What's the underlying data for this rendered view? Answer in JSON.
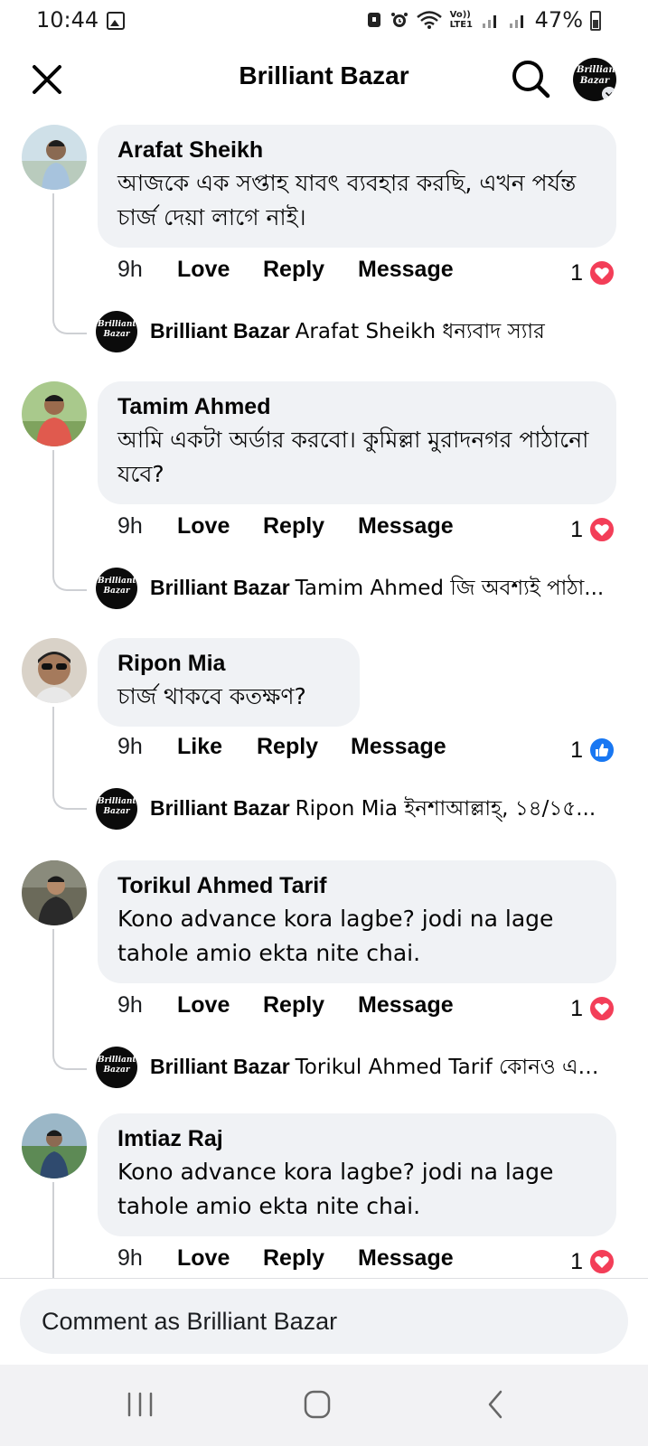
{
  "status_bar": {
    "time": "10:44",
    "battery": "47%",
    "network_label": "Vo)) LTE1"
  },
  "header": {
    "title": "Brilliant Bazar",
    "page_avatar_text": "Brilliant Bazar"
  },
  "comments": [
    {
      "author": "Arafat Sheikh",
      "text": "আজকে এক সপ্তাহ যাবৎ ব্যবহার করছি, এখন পর্যন্ত চার্জ দেয়া লাগে নাই।",
      "time": "9h",
      "react_label": "Love",
      "reply_label": "Reply",
      "message_label": "Message",
      "reaction_count": "1",
      "reaction_type": "love-icon",
      "reply": {
        "author": "Brilliant Bazar",
        "text": "Arafat Sheikh ধন্যবাদ স্যার"
      }
    },
    {
      "author": "Tamim Ahmed",
      "text": "আমি একটা অর্ডার করবো। কুমিল্লা মুরাদনগর পাঠানো যবে?",
      "time": "9h",
      "react_label": "Love",
      "reply_label": "Reply",
      "message_label": "Message",
      "reaction_count": "1",
      "reaction_type": "love-icon",
      "reply": {
        "author": "Brilliant Bazar",
        "text": "Tamim Ahmed জি অবশ্যই পাঠা..."
      }
    },
    {
      "author": "Ripon Mia",
      "text": "চার্জ থাকবে কতক্ষণ?",
      "time": "9h",
      "react_label": "Like",
      "reply_label": "Reply",
      "message_label": "Message",
      "reaction_count": "1",
      "reaction_type": "like-icon",
      "reply": {
        "author": "Brilliant Bazar",
        "text": "Ripon Mia ইনশাআল্লাহ্‌, ১৪/১৫..."
      }
    },
    {
      "author": "Torikul Ahmed Tarif",
      "text": "Kono advance kora lagbe? jodi na lage tahole amio ekta nite chai.",
      "time": "9h",
      "react_label": "Love",
      "reply_label": "Reply",
      "message_label": "Message",
      "reaction_count": "1",
      "reaction_type": "love-icon",
      "reply": {
        "author": "Brilliant Bazar",
        "text": "Torikul Ahmed Tarif কোনও এড..."
      }
    },
    {
      "author": "Imtiaz Raj",
      "text": "Kono advance kora lagbe? jodi na lage tahole amio ekta nite chai.",
      "time": "9h",
      "react_label": "Love",
      "reply_label": "Reply",
      "message_label": "Message",
      "reaction_count": "1",
      "reaction_type": "love-icon"
    }
  ],
  "composer": {
    "placeholder": "Comment as Brilliant Bazar"
  },
  "colors": {
    "bubble": "#f0f2f5",
    "love": "#f33e58",
    "like": "#1877f2",
    "thread_line": "#ced0d4"
  }
}
